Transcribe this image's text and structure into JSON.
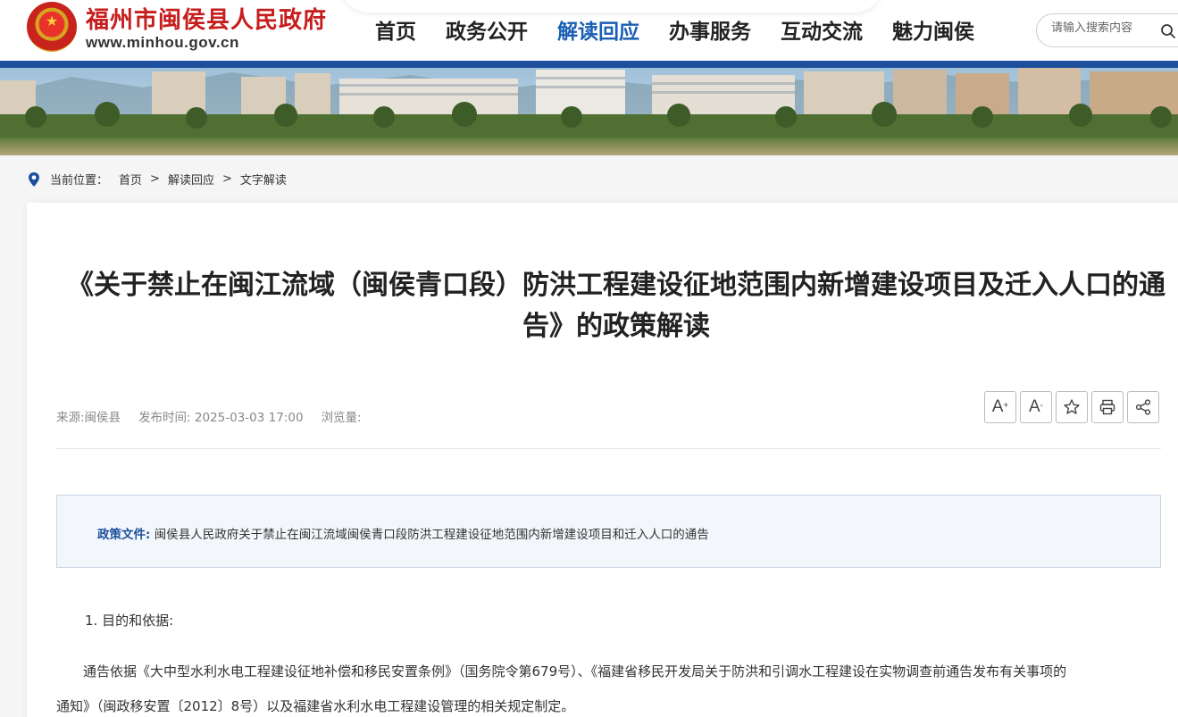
{
  "header": {
    "site_name": "福州市闽侯县人民政府",
    "site_url": "www.minhou.gov.cn"
  },
  "nav": {
    "items": [
      {
        "label": "首页",
        "active": false
      },
      {
        "label": "政务公开",
        "active": false
      },
      {
        "label": "解读回应",
        "active": true
      },
      {
        "label": "办事服务",
        "active": false
      },
      {
        "label": "互动交流",
        "active": false
      },
      {
        "label": "魅力闽侯",
        "active": false
      }
    ]
  },
  "search": {
    "placeholder": "请输入搜索内容",
    "icon": "search-icon"
  },
  "breadcrumb": {
    "label": "当前位置：",
    "items": [
      "首页",
      "解读回应",
      "文字解读"
    ],
    "separator": ">"
  },
  "article": {
    "title": "《关于禁止在闽江流域（闽侯青口段）防洪工程建设征地范围内新增建设项目及迁入人口的通告》的政策解读",
    "source": "来源:闽侯县",
    "publish_time": "发布时间: 2025-03-03 17:00",
    "views": "浏览量:",
    "tools": {
      "font_larger": "A",
      "font_larger_sup": "+",
      "font_smaller": "A",
      "font_smaller_sup": "-",
      "favorite": "star-icon",
      "print": "print-icon",
      "share": "share-icon"
    },
    "policy_label": "政策文件:",
    "policy_text": "闽侯县人民政府关于禁止在闽江流域闽侯青口段防洪工程建设征地范围内新增建设项目和迁入人口的通告",
    "section1_heading": "1. 目的和依据:",
    "paragraph1_line1": "通告依据《大中型水利水电工程建设征地补偿和移民安置条例》（国务院令第679号）、《福建省移民开发局关于防洪和引调水工程建设在实物调查前通告发布有关事项的",
    "paragraph1_line2": "通知》（闽政移安置〔2012〕8号）以及福建省水利水电工程建设管理的相关规定制定。"
  },
  "colors": {
    "brand_red": "#c61d1d",
    "nav_active": "#1a5fb4",
    "banner_bar": "#1d4f9c",
    "policy_label": "#1d4f9c"
  }
}
